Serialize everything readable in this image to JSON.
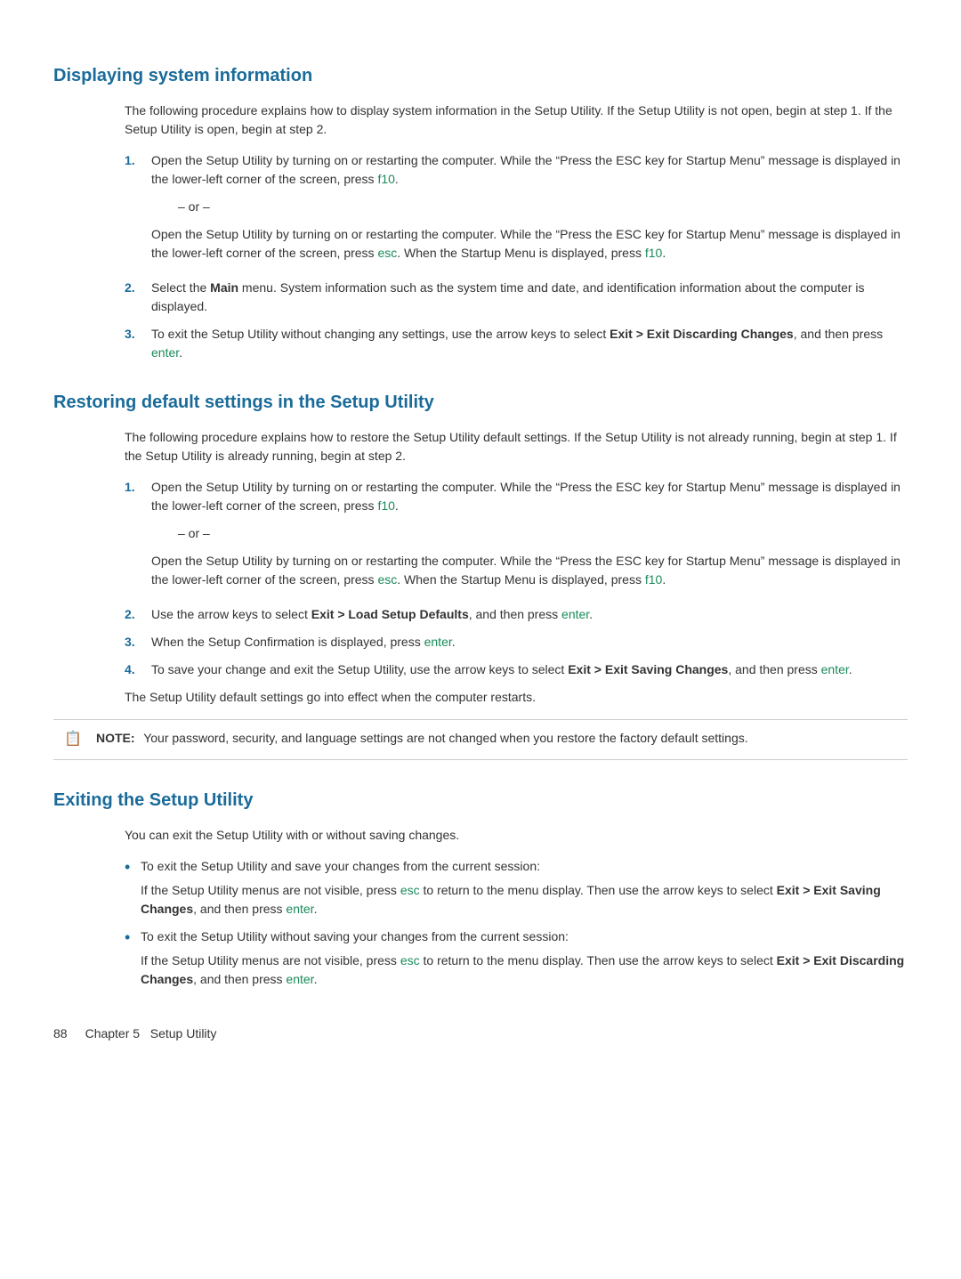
{
  "sections": [
    {
      "id": "displaying-system-information",
      "heading": "Displaying system information",
      "intro": "The following procedure explains how to display system information in the Setup Utility. If the Setup Utility is not open, begin at step 1. If the Setup Utility is open, begin at step 2.",
      "steps": [
        {
          "number": "1.",
          "content_parts": [
            {
              "type": "text",
              "text": "Open the Setup Utility by turning on or restarting the computer. While the “Press the ESC key for Startup Menu” message is displayed in the lower-left corner of the screen, press "
            },
            {
              "type": "link",
              "text": "f10"
            },
            {
              "type": "text",
              "text": "."
            }
          ],
          "or": true,
          "or_content_parts": [
            {
              "type": "text",
              "text": "Open the Setup Utility by turning on or restarting the computer. While the “Press the ESC key for Startup Menu” message is displayed in the lower-left corner of the screen, press "
            },
            {
              "type": "link",
              "text": "esc"
            },
            {
              "type": "text",
              "text": ". When the Startup Menu is displayed, press "
            },
            {
              "type": "link",
              "text": "f10"
            },
            {
              "type": "text",
              "text": "."
            }
          ]
        },
        {
          "number": "2.",
          "content_parts": [
            {
              "type": "text",
              "text": "Select the "
            },
            {
              "type": "bold",
              "text": "Main"
            },
            {
              "type": "text",
              "text": " menu. System information such as the system time and date, and identification information about the computer is displayed."
            }
          ]
        },
        {
          "number": "3.",
          "content_parts": [
            {
              "type": "text",
              "text": "To exit the Setup Utility without changing any settings, use the arrow keys to select "
            },
            {
              "type": "bold",
              "text": "Exit > Exit Discarding Changes"
            },
            {
              "type": "text",
              "text": ", and then press "
            },
            {
              "type": "link",
              "text": "enter"
            },
            {
              "type": "text",
              "text": "."
            }
          ]
        }
      ]
    },
    {
      "id": "restoring-default-settings",
      "heading": "Restoring default settings in the Setup Utility",
      "intro": "The following procedure explains how to restore the Setup Utility default settings. If the Setup Utility is not already running, begin at step 1. If the Setup Utility is already running, begin at step 2.",
      "steps": [
        {
          "number": "1.",
          "content_parts": [
            {
              "type": "text",
              "text": "Open the Setup Utility by turning on or restarting the computer. While the “Press the ESC key for Startup Menu” message is displayed in the lower-left corner of the screen, press "
            },
            {
              "type": "link",
              "text": "f10"
            },
            {
              "type": "text",
              "text": "."
            }
          ],
          "or": true,
          "or_content_parts": [
            {
              "type": "text",
              "text": "Open the Setup Utility by turning on or restarting the computer. While the “Press the ESC key for Startup Menu” message is displayed in the lower-left corner of the screen, press "
            },
            {
              "type": "link",
              "text": "esc"
            },
            {
              "type": "text",
              "text": ". When the Startup Menu is displayed, press "
            },
            {
              "type": "link",
              "text": "f10"
            },
            {
              "type": "text",
              "text": "."
            }
          ]
        },
        {
          "number": "2.",
          "content_parts": [
            {
              "type": "text",
              "text": "Use the arrow keys to select "
            },
            {
              "type": "bold",
              "text": "Exit > Load Setup Defaults"
            },
            {
              "type": "text",
              "text": ", and then press "
            },
            {
              "type": "link",
              "text": "enter"
            },
            {
              "type": "text",
              "text": "."
            }
          ]
        },
        {
          "number": "3.",
          "content_parts": [
            {
              "type": "text",
              "text": "When the Setup Confirmation is displayed, press "
            },
            {
              "type": "link",
              "text": "enter"
            },
            {
              "type": "text",
              "text": "."
            }
          ]
        },
        {
          "number": "4.",
          "content_parts": [
            {
              "type": "text",
              "text": "To save your change and exit the Setup Utility, use the arrow keys to select "
            },
            {
              "type": "bold",
              "text": "Exit > Exit Saving Changes"
            },
            {
              "type": "text",
              "text": ", and then press "
            },
            {
              "type": "link",
              "text": "enter"
            },
            {
              "type": "text",
              "text": "."
            }
          ]
        }
      ],
      "after_steps_text": "The Setup Utility default settings go into effect when the computer restarts.",
      "note": {
        "icon": "📋",
        "label": "NOTE:",
        "text": "Your password, security, and language settings are not changed when you restore the factory default settings."
      }
    },
    {
      "id": "exiting-setup-utility",
      "heading": "Exiting the Setup Utility",
      "intro": "You can exit the Setup Utility with or without saving changes.",
      "bullets": [
        {
          "intro_parts": [
            {
              "type": "text",
              "text": "To exit the Setup Utility and save your changes from the current session:"
            }
          ],
          "sub_parts": [
            {
              "type": "text",
              "text": "If the Setup Utility menus are not visible, press "
            },
            {
              "type": "link",
              "text": "esc"
            },
            {
              "type": "text",
              "text": " to return to the menu display. Then use the arrow keys to select "
            },
            {
              "type": "bold",
              "text": "Exit > Exit Saving Changes"
            },
            {
              "type": "text",
              "text": ", and then press "
            },
            {
              "type": "link",
              "text": "enter"
            },
            {
              "type": "text",
              "text": "."
            }
          ]
        },
        {
          "intro_parts": [
            {
              "type": "text",
              "text": "To exit the Setup Utility without saving your changes from the current session:"
            }
          ],
          "sub_parts": [
            {
              "type": "text",
              "text": "If the Setup Utility menus are not visible, press "
            },
            {
              "type": "link",
              "text": "esc"
            },
            {
              "type": "text",
              "text": " to return to the menu display. Then use the arrow keys to select "
            },
            {
              "type": "bold",
              "text": "Exit > Exit Discarding Changes"
            },
            {
              "type": "text",
              "text": ", and then press "
            },
            {
              "type": "link",
              "text": "enter"
            },
            {
              "type": "text",
              "text": "."
            }
          ]
        }
      ]
    }
  ],
  "footer": {
    "page_number": "88",
    "chapter": "Chapter 5",
    "chapter_title": "Setup Utility"
  },
  "colors": {
    "heading": "#1a6b9a",
    "link": "#1a8a5a",
    "body": "#333333"
  }
}
